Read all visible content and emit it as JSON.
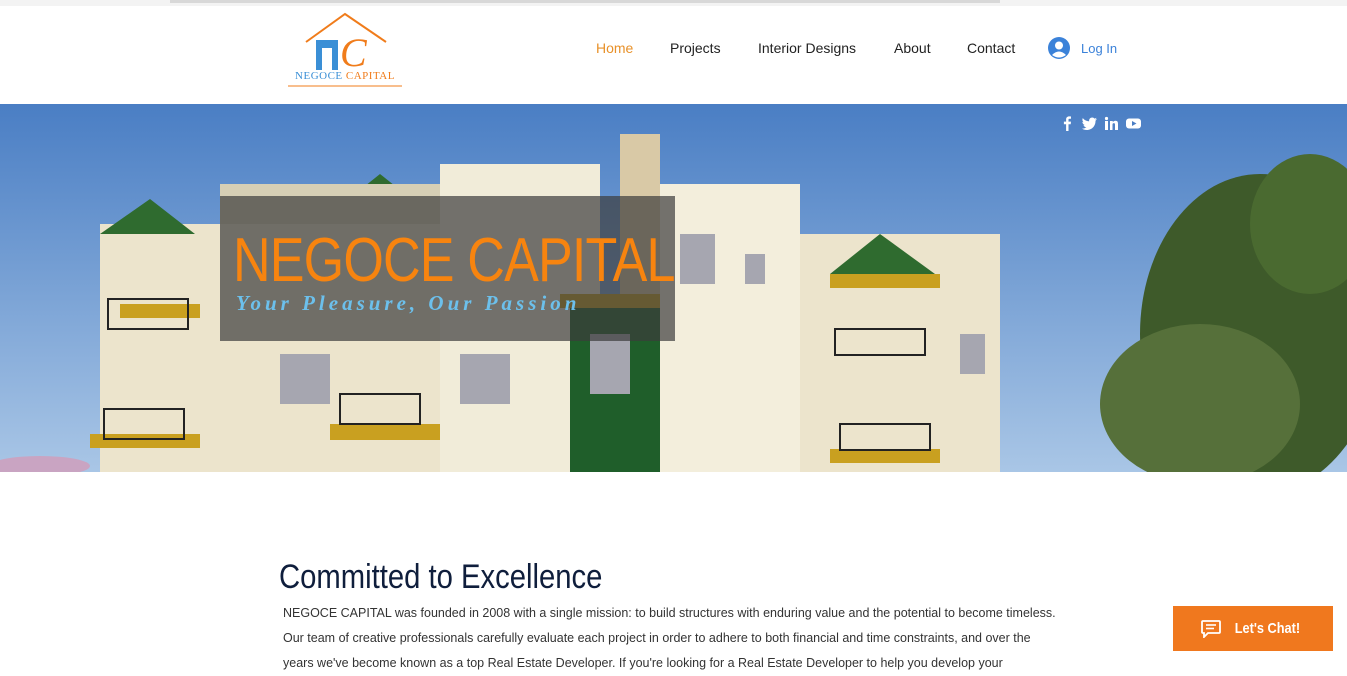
{
  "brand": {
    "logo_word_1": "NEGOCE",
    "logo_word_2": "CAPITAL",
    "logo_letters": "nC"
  },
  "nav": {
    "items": [
      {
        "label": "Home",
        "active": true
      },
      {
        "label": "Projects",
        "active": false
      },
      {
        "label": "Interior Designs",
        "active": false
      },
      {
        "label": "About",
        "active": false
      },
      {
        "label": "Contact",
        "active": false
      }
    ],
    "login_label": "Log In"
  },
  "social": [
    "facebook-icon",
    "twitter-icon",
    "linkedin-icon",
    "youtube-icon"
  ],
  "hero": {
    "title": "NEGOCE CAPITAL",
    "tagline": "Your Pleasure, Our Passion"
  },
  "about": {
    "heading": "Committed to Excellence",
    "paragraph": "NEGOCE CAPITAL was founded in 2008 with a single mission: to build structures with enduring value and the potential to become timeless. Our team of creative professionals carefully evaluate each project in order to adhere to both financial and time constraints, and over the years we've become known as a top Real Estate Developer. If you're looking for a Real Estate Developer to help you develop your"
  },
  "chat": {
    "label": "Let's Chat!"
  },
  "colors": {
    "accent": "#f07c1b",
    "link": "#3b82d9",
    "heading": "#0f1e3c",
    "tagline": "#6cc0ec"
  }
}
